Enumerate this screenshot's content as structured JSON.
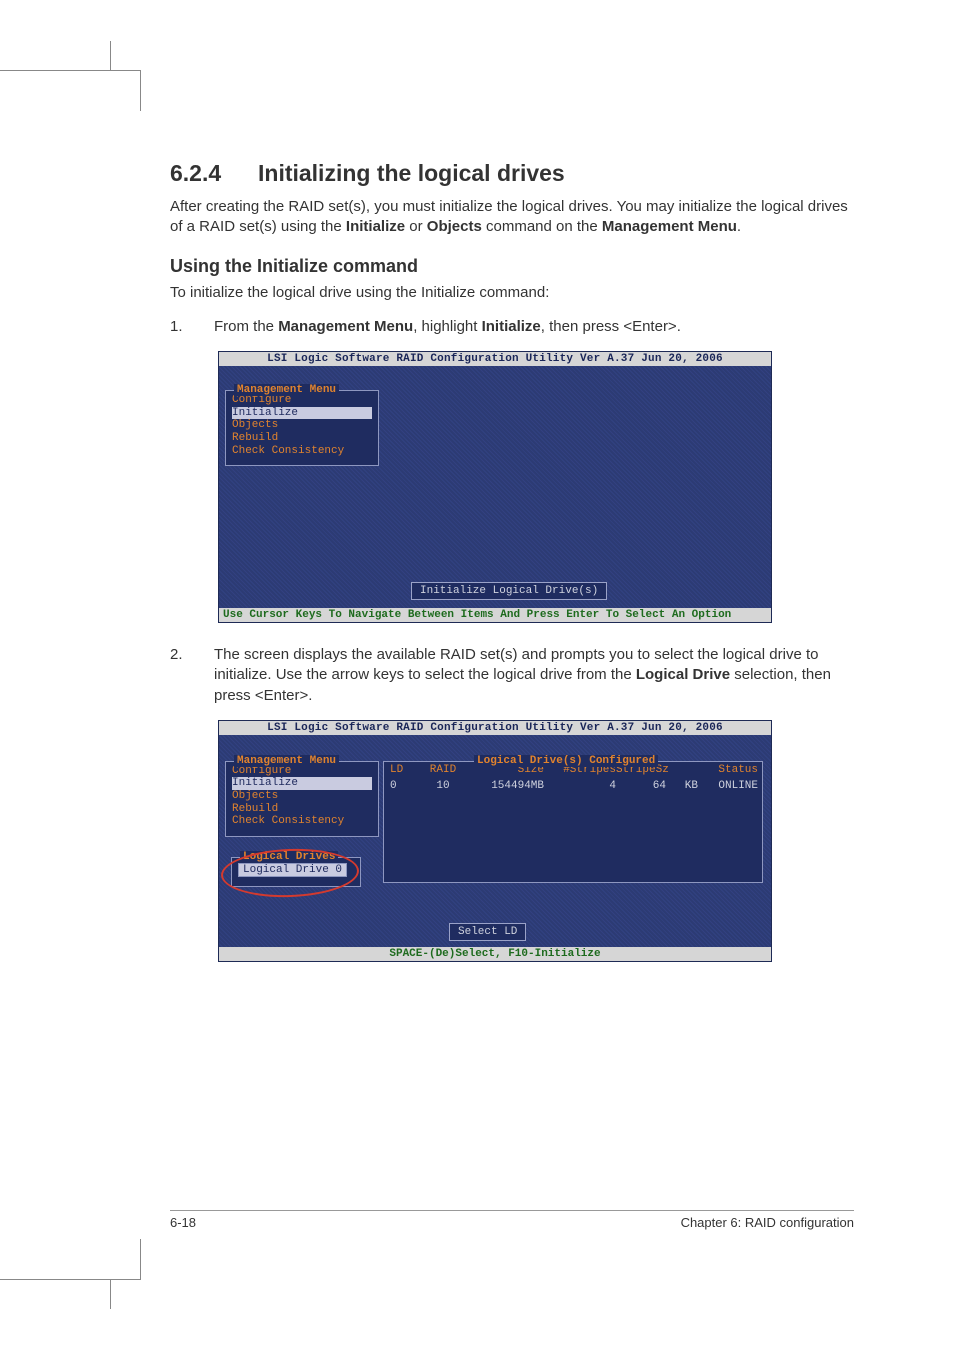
{
  "section": {
    "number": "6.2.4",
    "title": "Initializing the logical drives"
  },
  "intro": {
    "pre": "After creating the RAID set(s), you must initialize the logical drives. You may initialize the logical drives of a RAID set(s) using the ",
    "b1": "Initialize",
    "mid1": " or ",
    "b2": "Objects",
    "mid2": " command on the ",
    "b3": "Management Menu",
    "post": "."
  },
  "subheading": "Using the Initialize command",
  "sublead": "To initialize the logical drive using the Initialize command:",
  "steps": {
    "s1": {
      "n": "1.",
      "pre": "From the ",
      "b1": "Management Menu",
      "mid1": ", highlight ",
      "b2": "Initialize",
      "post": ", then press <Enter>."
    },
    "s2": {
      "n": "2.",
      "pre": "The screen displays the available RAID set(s) and prompts you to select the logical drive to initialize. Use the arrow keys to select the logical drive from the ",
      "b1": "Logical Drive",
      "post": " selection, then press <Enter>."
    }
  },
  "shot1": {
    "title": "LSI Logic Software RAID Configuration Utility Ver A.37 Jun 20, 2006",
    "menu_title": "Management Menu",
    "items": [
      "Configure",
      "Initialize",
      "Objects",
      "Rebuild",
      "Check Consistency"
    ],
    "selected_index": 1,
    "button": "Initialize Logical Drive(s)",
    "footer": "Use Cursor Keys To Navigate Between Items And Press Enter To Select An Option"
  },
  "shot2": {
    "title": "LSI Logic Software RAID Configuration Utility Ver A.37 Jun 20, 2006",
    "menu_title": "Management Menu",
    "items": [
      "Configure",
      "Initialize",
      "Objects",
      "Rebuild",
      "Check Consistency"
    ],
    "selected_index": 1,
    "ld_panel_title": "Logical Drives",
    "ld_item": "Logical Drive 0",
    "table_title": "Logical Drive(s) Configured",
    "thead": [
      "LD",
      "RAID",
      "Size",
      "#Stripes",
      "StripeSz",
      "",
      "Status"
    ],
    "trow": [
      "0",
      "10",
      "154494MB",
      "4",
      "64",
      "KB",
      "ONLINE"
    ],
    "button": "Select LD",
    "footer": "SPACE-(De)Select, F10-Initialize"
  },
  "page_footer": {
    "left": "6-18",
    "right": "Chapter 6: RAID configuration"
  }
}
